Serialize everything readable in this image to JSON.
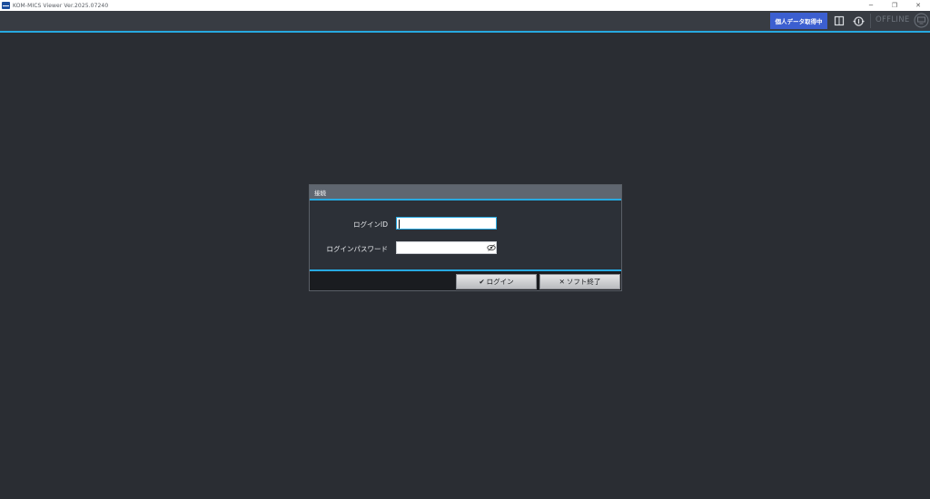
{
  "window": {
    "title": "KOM-MICS Viewer  Ver.2025.07240",
    "minimize_glyph": "─",
    "restore_glyph": "❐",
    "close_glyph": "✕"
  },
  "header": {
    "data_badge": "個人データ取得中",
    "status": "OFFLINE",
    "icons": [
      "book-icon",
      "sync-icon",
      "offline-monitor-icon"
    ]
  },
  "dialog": {
    "title": "接続",
    "login_id_label": "ログインID",
    "login_id_value": "",
    "password_label": "ログインパスワード",
    "password_value": "",
    "login_button": "ログイン",
    "login_glyph": "✔",
    "exit_button": "ソフト終了",
    "exit_glyph": "✕"
  },
  "colors": {
    "accent": "#27a9e1",
    "badge": "#3c5fd0",
    "background": "#2a2d33",
    "header": "#383c43"
  }
}
